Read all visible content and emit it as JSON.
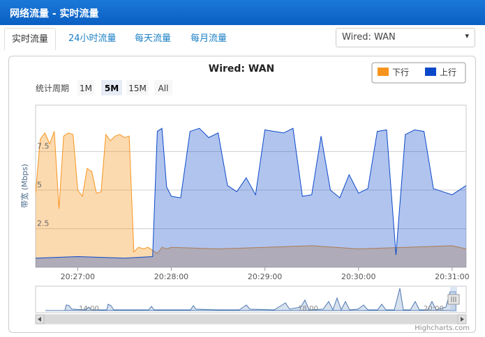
{
  "window": {
    "title": "网络流量 - 实时流量"
  },
  "tabs": [
    {
      "label": "实时流量",
      "active": true
    },
    {
      "label": "24小时流量",
      "active": false
    },
    {
      "label": "每天流量",
      "active": false
    },
    {
      "label": "每月流量",
      "active": false
    }
  ],
  "interface_select": {
    "value": "Wired: WAN",
    "caret": "▾"
  },
  "range_selector": {
    "label": "统计周期",
    "buttons": [
      {
        "label": "1M",
        "selected": false
      },
      {
        "label": "5M",
        "selected": true
      },
      {
        "label": "15M",
        "selected": false
      },
      {
        "label": "All",
        "selected": false
      }
    ]
  },
  "navigator_labels": [
    "14:00",
    "18:00",
    "20:00"
  ],
  "credits": "Highcharts.com",
  "chart_data": {
    "type": "area",
    "title": "Wired: WAN",
    "ylabel": "带宽 (Mbps)",
    "xlabel": "",
    "ylim": [
      0,
      10.5
    ],
    "yticks": [
      2.5,
      5,
      7.5
    ],
    "xticks": [
      "20:27:00",
      "20:28:00",
      "20:29:00",
      "20:30:00",
      "20:31:00"
    ],
    "grid": true,
    "legend_position": "top-right",
    "colors": {
      "down": "#f7941d",
      "up": "#0b48c9"
    },
    "series": [
      {
        "name": "下行",
        "x": [
          "20:26:33",
          "20:26:36",
          "20:26:39",
          "20:26:42",
          "20:26:45",
          "20:26:48",
          "20:26:51",
          "20:26:54",
          "20:26:57",
          "20:27:00",
          "20:27:03",
          "20:27:06",
          "20:27:09",
          "20:27:12",
          "20:27:15",
          "20:27:18",
          "20:27:21",
          "20:27:24",
          "20:27:27",
          "20:27:30",
          "20:27:33",
          "20:27:36",
          "20:27:39",
          "20:27:42",
          "20:27:45",
          "20:27:48",
          "20:27:51",
          "20:27:54",
          "20:27:57",
          "20:28:00",
          "20:28:30",
          "20:29:00",
          "20:29:30",
          "20:30:00",
          "20:30:30",
          "20:31:00",
          "20:31:09"
        ],
        "values": [
          4.8,
          8.3,
          8.7,
          8.0,
          8.8,
          3.8,
          8.5,
          8.7,
          8.6,
          5.0,
          4.6,
          6.4,
          6.2,
          4.8,
          4.9,
          8.6,
          8.2,
          8.5,
          8.6,
          8.4,
          8.5,
          1.0,
          1.3,
          1.2,
          1.3,
          1.1,
          0.9,
          1.3,
          1.2,
          1.3,
          1.2,
          1.3,
          1.4,
          1.2,
          1.3,
          1.4,
          1.2
        ]
      },
      {
        "name": "上行",
        "x": [
          "20:26:33",
          "20:27:00",
          "20:27:30",
          "20:27:48",
          "20:27:51",
          "20:27:54",
          "20:27:57",
          "20:28:00",
          "20:28:06",
          "20:28:12",
          "20:28:18",
          "20:28:24",
          "20:28:30",
          "20:28:36",
          "20:28:42",
          "20:28:48",
          "20:28:54",
          "20:29:00",
          "20:29:06",
          "20:29:12",
          "20:29:18",
          "20:29:24",
          "20:29:30",
          "20:29:36",
          "20:29:42",
          "20:29:48",
          "20:29:54",
          "20:30:00",
          "20:30:06",
          "20:30:12",
          "20:30:18",
          "20:30:24",
          "20:30:30",
          "20:30:36",
          "20:30:42",
          "20:30:48",
          "20:30:54",
          "20:31:00",
          "20:31:06",
          "20:31:09"
        ],
        "values": [
          0.6,
          0.7,
          0.6,
          0.7,
          8.8,
          9.0,
          5.2,
          4.6,
          4.5,
          8.8,
          9.0,
          8.4,
          8.7,
          5.3,
          4.9,
          5.8,
          4.7,
          8.9,
          8.8,
          8.7,
          9.0,
          4.6,
          4.7,
          8.5,
          5.0,
          4.5,
          6.0,
          4.8,
          5.1,
          8.8,
          8.9,
          0.8,
          8.6,
          8.9,
          8.8,
          5.1,
          4.9,
          4.7,
          5.1,
          5.3
        ]
      }
    ]
  }
}
